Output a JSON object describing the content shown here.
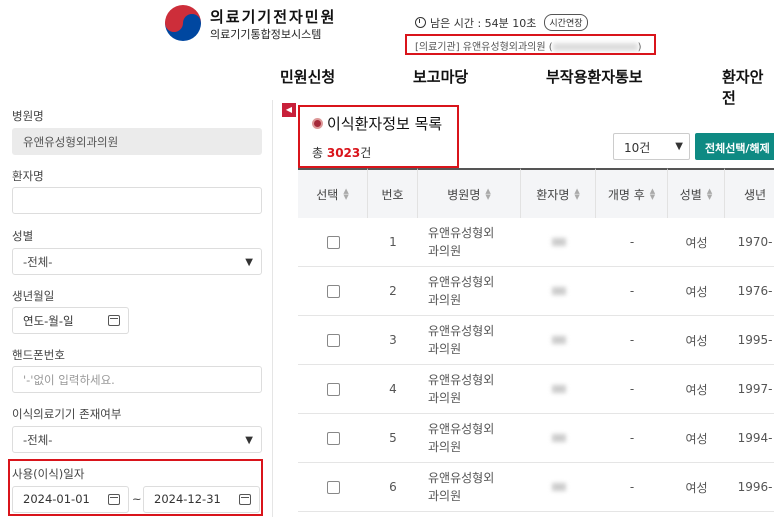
{
  "brand": {
    "title": "의료기기전자민원",
    "subtitle": "의료기기통합정보시스템"
  },
  "session": {
    "time_label": "남은 시간 : 54분 10초",
    "extend_label": "시간연장"
  },
  "org": {
    "label": "[의료기관] 유앤유성형외과의원 (",
    "close": ")"
  },
  "gnb": [
    "민원신청",
    "보고마당",
    "부작용환자통보",
    "환자안전"
  ],
  "sidebar": {
    "hospital_label": "병원명",
    "hospital_value": "유앤유성형외과의원",
    "patient_label": "환자명",
    "patient_value": "",
    "gender_label": "성별",
    "gender_value": "-전체-",
    "birth_label": "생년월일",
    "birth_value": "연도-월-일",
    "phone_label": "핸드폰번호",
    "phone_placeholder": "'-'없이 입력하세요.",
    "device_label": "이식의료기기 존재여부",
    "device_value": "-전체-",
    "use_date_label": "사용(이식)일자",
    "date_from": "2024-01-01",
    "date_sep": "~",
    "date_to": "2024-12-31"
  },
  "main": {
    "title": "이식환자정보 목록",
    "total_prefix": "총 ",
    "total_count": "3023",
    "total_suffix": "건",
    "per_page": "10건",
    "select_all_label": "전체선택/해제",
    "columns": [
      "선택",
      "번호",
      "병원명",
      "환자명",
      "개명 후",
      "성별",
      "생년"
    ],
    "rows": [
      {
        "no": "1",
        "hospital": [
          "유앤유성형외",
          "과의원"
        ],
        "renamed": "-",
        "gender": "여성",
        "birth": "1970-"
      },
      {
        "no": "2",
        "hospital": [
          "유앤유성형외",
          "과의원"
        ],
        "renamed": "-",
        "gender": "여성",
        "birth": "1976-"
      },
      {
        "no": "3",
        "hospital": [
          "유앤유성형외",
          "과의원"
        ],
        "renamed": "-",
        "gender": "여성",
        "birth": "1995-"
      },
      {
        "no": "4",
        "hospital": [
          "유앤유성형외",
          "과의원"
        ],
        "renamed": "-",
        "gender": "여성",
        "birth": "1997-"
      },
      {
        "no": "5",
        "hospital": [
          "유앤유성형외",
          "과의원"
        ],
        "renamed": "-",
        "gender": "여성",
        "birth": "1994-"
      },
      {
        "no": "6",
        "hospital": [
          "유앤유성형외",
          "과의원"
        ],
        "renamed": "-",
        "gender": "여성",
        "birth": "1996-"
      }
    ]
  },
  "colors": {
    "accent_red": "#d9141b",
    "teal": "#0e8a83",
    "brand_red": "#cd2e3a",
    "brand_blue": "#0047a0"
  }
}
